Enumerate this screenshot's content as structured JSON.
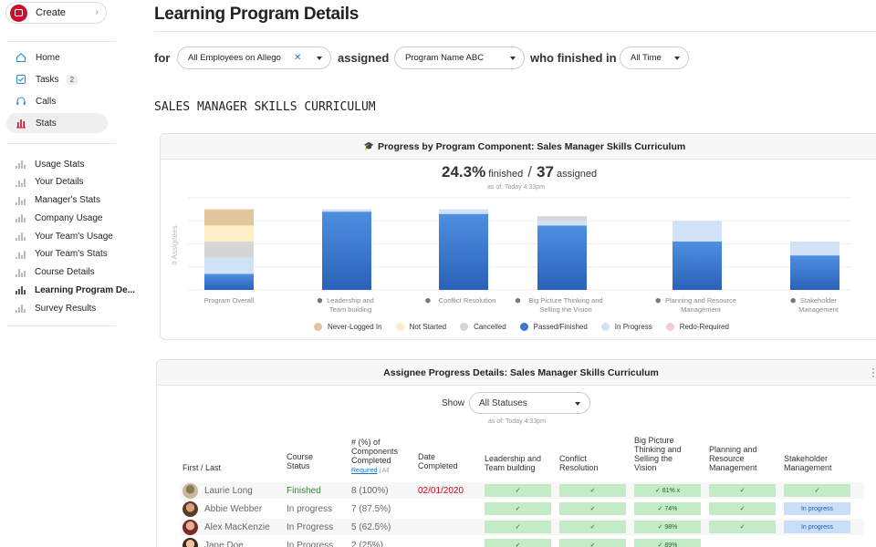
{
  "sidebar": {
    "create_label": "Create",
    "nav": [
      {
        "label": "Home",
        "icon": "home-icon"
      },
      {
        "label": "Tasks",
        "icon": "tasks-icon",
        "badge": "2"
      },
      {
        "label": "Calls",
        "icon": "headset-icon"
      },
      {
        "label": "Stats",
        "icon": "stats-icon",
        "active": true
      }
    ],
    "sub": [
      "Usage Stats",
      "Your Details",
      "Manager's Stats",
      "Company Usage",
      "Your Team's Usage",
      "Your Team's Stats",
      "Course Details",
      "Learning Program De...",
      "Survey Results"
    ],
    "accent": "#c8102e"
  },
  "header": {
    "title": "Learning Program Details",
    "for_label": "for",
    "assigned_label": "assigned",
    "finished_label": "who finished in",
    "audience_value": "All Employees on Allego",
    "program_value": "Program Name ABC",
    "time_value": "All Time"
  },
  "section_title": "SALES MANAGER SKILLS CURRICULUM",
  "progress_card": {
    "title": "Progress by Program Component: Sales Manager Skills Curriculum",
    "percent": "24.3%",
    "finished_label": "finished",
    "slash": "/",
    "total": "37",
    "assigned_label": "assigned",
    "as_of": "as of: Today 4:33pm"
  },
  "chart_data": {
    "type": "bar",
    "stacked": true,
    "ylabel": "# Assignees",
    "categories": [
      "Program Overall",
      "Leadership and Team building",
      "Conflict Resolution",
      "Big Picture Thinking and Selling the Vision",
      "Planning and Resource Management",
      "Stakeholder Management"
    ],
    "category_lines": [
      [
        "Program Overall"
      ],
      [
        "Leadership and",
        "Team building"
      ],
      [
        "Conflict Resolution"
      ],
      [
        "Big Picture Thinking and",
        "Selling the Vision"
      ],
      [
        "Planning and Resource",
        "Management"
      ],
      [
        "Stakeholder",
        "Management"
      ]
    ],
    "ylim": [
      0,
      40
    ],
    "grid": true,
    "legend_position": "bottom",
    "series": [
      {
        "name": "Passed/Finished",
        "color": "#3b78d0",
        "values": [
          7,
          34,
          33,
          28,
          21,
          15
        ]
      },
      {
        "name": "In Progress",
        "color": "#cfe2f7",
        "values": [
          7,
          1,
          2,
          2,
          9,
          6
        ]
      },
      {
        "name": "Cancelled",
        "color": "#d6d6d6",
        "values": [
          7,
          0,
          0,
          2,
          0,
          0
        ]
      },
      {
        "name": "Not Started",
        "color": "#fdeec8",
        "values": [
          7,
          0,
          0,
          0,
          0,
          0
        ]
      },
      {
        "name": "Never-Logged In",
        "color": "#e2c59b",
        "values": [
          7,
          0,
          0,
          0,
          0,
          0
        ]
      },
      {
        "name": "Redo-Required",
        "color": "#f4cccc",
        "values": [
          0,
          0,
          0,
          0,
          0,
          0
        ]
      }
    ],
    "legend": [
      {
        "name": "Never-Logged In",
        "color": "#e2c59b"
      },
      {
        "name": "Not Started",
        "color": "#fdeec8"
      },
      {
        "name": "Cancelled",
        "color": "#d6d6d6"
      },
      {
        "name": "Passed/Finished",
        "color": "#3b78d0"
      },
      {
        "name": "In Progress",
        "color": "#cfe2f7"
      },
      {
        "name": "Redo-Required",
        "color": "#f4cccc"
      }
    ]
  },
  "assignee_card": {
    "title": "Assignee Progress Details: Sales Manager Skills Curriculum",
    "show_label": "Show",
    "status_value": "All Statuses",
    "as_of": "as of: Today 4:33pm",
    "headers": {
      "name": "First / Last",
      "status": [
        "Course",
        "Status"
      ],
      "components": [
        "# (%) of",
        "Components",
        "Completed"
      ],
      "required": "Required",
      "sep": " | ",
      "all": "All",
      "date": [
        "Date",
        "Completed"
      ],
      "c1": [
        "Leadership and",
        "Team building"
      ],
      "c2": [
        "Conflict",
        "Resolution"
      ],
      "c3": [
        "Big Picture",
        "Thinking and",
        "Selling the",
        "Vision"
      ],
      "c4": [
        "Planning and",
        "Resource",
        "Management"
      ],
      "c5": [
        "Stakeholder",
        "Management"
      ]
    },
    "rows": [
      {
        "name": "Laurie Long",
        "status": "Finished",
        "completed": "8 (100%)",
        "date": "02/01/2020",
        "cells": [
          [
            "green",
            "✓"
          ],
          [
            "green",
            "✓"
          ],
          [
            "green",
            "✓ 81% x"
          ],
          [
            "green",
            "✓"
          ],
          [
            "green",
            "✓"
          ]
        ]
      },
      {
        "name": "Abbie Webber",
        "status": "In progress",
        "completed": "7 (87.5%)",
        "date": "",
        "cells": [
          [
            "green",
            "✓"
          ],
          [
            "green",
            "✓"
          ],
          [
            "green",
            "✓ 74%"
          ],
          [
            "green",
            "✓"
          ],
          [
            "blue",
            "In progress"
          ]
        ]
      },
      {
        "name": "Alex MacKenzie",
        "status": "In Progress",
        "completed": "5 (62.5%)",
        "date": "",
        "cells": [
          [
            "green",
            "✓"
          ],
          [
            "green",
            "✓"
          ],
          [
            "green",
            "✓ 98%"
          ],
          [
            "green",
            "✓"
          ],
          [
            "blue",
            "In progress"
          ]
        ]
      },
      {
        "name": "Jane Doe",
        "status": "In Progress",
        "completed": "2 (25%)",
        "date": "",
        "cells": [
          [
            "green",
            "✓"
          ],
          [
            "green",
            "✓"
          ],
          [
            "green",
            "✓ 89%"
          ],
          [
            "none",
            ""
          ],
          [
            "none",
            ""
          ]
        ]
      }
    ],
    "status_colors": {
      "finished": "#2e8b3a",
      "date": "#d0021b"
    }
  }
}
